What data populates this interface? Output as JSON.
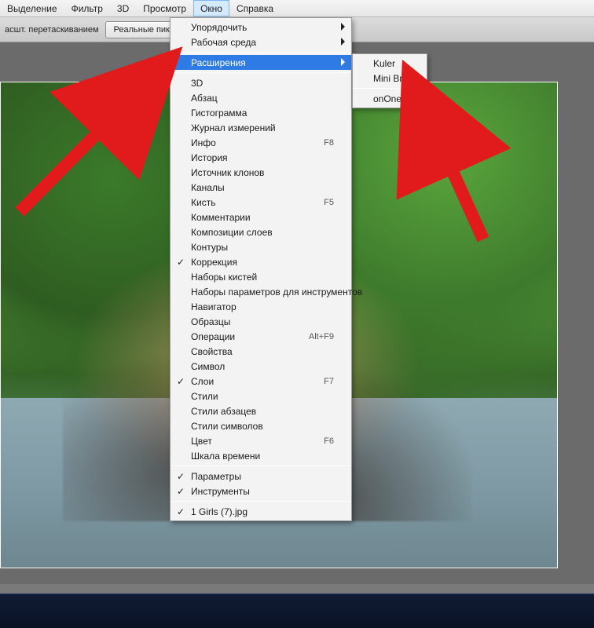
{
  "menubar": {
    "items": [
      "Выделение",
      "Фильтр",
      "3D",
      "Просмотр",
      "Окно",
      "Справка"
    ],
    "active_index": 4
  },
  "optbar": {
    "text": "асшт. перетаскиванием",
    "btn1": "Реальные пикселы"
  },
  "mainmenu": {
    "groups": [
      [
        {
          "label": "Упорядочить",
          "submenu": true
        },
        {
          "label": "Рабочая среда",
          "submenu": true
        }
      ],
      [
        {
          "label": "Расширения",
          "submenu": true,
          "highlighted": true
        }
      ],
      [
        {
          "label": "3D"
        },
        {
          "label": "Абзац"
        },
        {
          "label": "Гистограмма"
        },
        {
          "label": "Журнал измерений"
        },
        {
          "label": "Инфо",
          "accel": "F8"
        },
        {
          "label": "История"
        },
        {
          "label": "Источник клонов"
        },
        {
          "label": "Каналы"
        },
        {
          "label": "Кисть",
          "accel": "F5"
        },
        {
          "label": "Комментарии"
        },
        {
          "label": "Композиции слоев"
        },
        {
          "label": "Контуры"
        },
        {
          "label": "Коррекция",
          "checked": true
        },
        {
          "label": "Наборы кистей"
        },
        {
          "label": "Наборы параметров для инструментов"
        },
        {
          "label": "Навигатор"
        },
        {
          "label": "Образцы"
        },
        {
          "label": "Операции",
          "accel": "Alt+F9"
        },
        {
          "label": "Свойства"
        },
        {
          "label": "Символ"
        },
        {
          "label": "Слои",
          "accel": "F7",
          "checked": true
        },
        {
          "label": "Стили"
        },
        {
          "label": "Стили абзацев"
        },
        {
          "label": "Стили символов"
        },
        {
          "label": "Цвет",
          "accel": "F6"
        },
        {
          "label": "Шкала времени"
        }
      ],
      [
        {
          "label": "Параметры",
          "checked": true
        },
        {
          "label": "Инструменты",
          "checked": true
        }
      ],
      [
        {
          "label": "1 Girls (7).jpg",
          "checked": true
        }
      ]
    ]
  },
  "submenu": {
    "items": [
      {
        "label": "Kuler"
      },
      {
        "label": "Mini Bridge"
      },
      {
        "label": "onOne",
        "sep_before": true
      }
    ]
  }
}
